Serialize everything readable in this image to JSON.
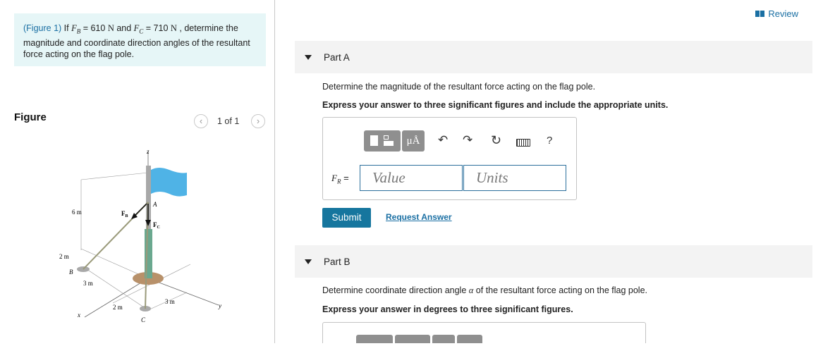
{
  "problem": {
    "figure_link": "(Figure 1)",
    "text_if": " If ",
    "fb_sym": "F",
    "fb_sub": "B",
    "eq1": " = 610 ",
    "unit_n": "N",
    "and": " and ",
    "fc_sym": "F",
    "fc_sub": "C",
    "eq2": " = 710 ",
    "rest": " , determine the magnitude and coordinate direction angles of the resultant force acting on the flag pole."
  },
  "figure": {
    "title": "Figure",
    "pager": "1 of 1",
    "prev_icon": "chevron-left-icon",
    "next_icon": "chevron-right-icon",
    "labels": {
      "z": "z",
      "x": "x",
      "y": "y",
      "A": "A",
      "B": "B",
      "C": "C",
      "FB": "F",
      "FB_sub": "B",
      "FC": "F",
      "FC_sub": "C",
      "d6m": "6 m",
      "d2m_top": "2 m",
      "d3m_left": "3 m",
      "d2m_bottom": "2 m",
      "d3m_right": "3 m"
    }
  },
  "review": {
    "label": "Review",
    "icon": "book-icon"
  },
  "partA": {
    "label": "Part A",
    "question": "Determine the magnitude of the resultant force acting on the flag pole.",
    "instruction": "Express your answer to three significant figures and include the appropriate units.",
    "toolbar": {
      "template_icon": "template-icon",
      "units_label": "μÅ",
      "undo_icon": "undo-icon",
      "redo_icon": "redo-icon",
      "reset_icon": "reset-icon",
      "keyboard_icon": "keyboard-icon",
      "help_label": "?"
    },
    "input_label_sym": "F",
    "input_label_sub": "R",
    "input_label_eq": " =",
    "value_placeholder": "Value",
    "units_placeholder": "Units",
    "submit": "Submit",
    "request": "Request Answer"
  },
  "partB": {
    "label": "Part B",
    "question_pre": "Determine coordinate direction angle ",
    "alpha": "α",
    "question_post": " of the resultant force acting on the flag pole.",
    "instruction": "Express your answer in degrees to three significant figures."
  },
  "colors": {
    "accent": "#16769e",
    "link": "#1a6fa3",
    "problem_bg": "#e6f6f7",
    "flag": "#4fb3e6"
  }
}
